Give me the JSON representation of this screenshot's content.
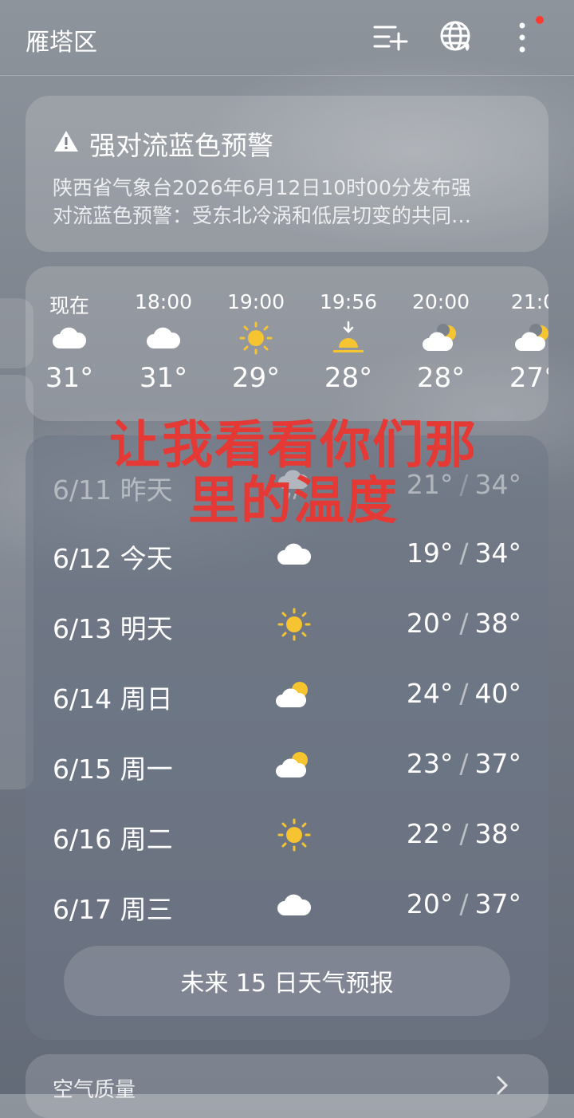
{
  "header": {
    "city": "雁塔区",
    "icons": [
      "add-city-icon",
      "globe-icon",
      "more-icon"
    ],
    "notification_dot_color": "#ff3b30"
  },
  "alert": {
    "icon": "warning-icon",
    "title": "强对流蓝色预警",
    "body_line1": "陕西省气象台2026年6月12日10时00分发布强",
    "body_line2": "对流蓝色预警：受东北冷涡和低层切变的共同…"
  },
  "hourly": [
    {
      "time": "现在",
      "icon": "cloud-icon",
      "temp": "31°"
    },
    {
      "time": "18:00",
      "icon": "cloud-icon",
      "temp": "31°"
    },
    {
      "time": "19:00",
      "icon": "sun-icon",
      "temp": "29°"
    },
    {
      "time": "19:56",
      "icon": "sunset-icon",
      "temp": "28°"
    },
    {
      "time": "20:00",
      "icon": "moon-cloud-icon",
      "temp": "28°"
    },
    {
      "time": "21:0",
      "icon": "moon-cloud-icon",
      "temp": "27°"
    }
  ],
  "daily": [
    {
      "date": "6/11 昨天",
      "icon": "rain-cloud-icon",
      "low": "21°",
      "high": "34°"
    },
    {
      "date": "6/12 今天",
      "icon": "cloud-icon",
      "low": "19°",
      "high": "34°"
    },
    {
      "date": "6/13 明天",
      "icon": "sun-icon",
      "low": "20°",
      "high": "38°"
    },
    {
      "date": "6/14 周日",
      "icon": "sun-cloud-icon",
      "low": "24°",
      "high": "40°"
    },
    {
      "date": "6/15 周一",
      "icon": "sun-cloud-icon",
      "low": "23°",
      "high": "37°"
    },
    {
      "date": "6/16 周二",
      "icon": "sun-icon",
      "low": "22°",
      "high": "38°"
    },
    {
      "date": "6/17 周三",
      "icon": "cloud-icon",
      "low": "20°",
      "high": "37°"
    }
  ],
  "forecast_button": "未来 15 日天气预报",
  "air_quality": {
    "title": "空气质量"
  },
  "overlay_text": {
    "line1": "让我看看你们那",
    "line2": "里的温度"
  },
  "colors": {
    "sun": "#f6c431",
    "overlay": "#e53935"
  }
}
